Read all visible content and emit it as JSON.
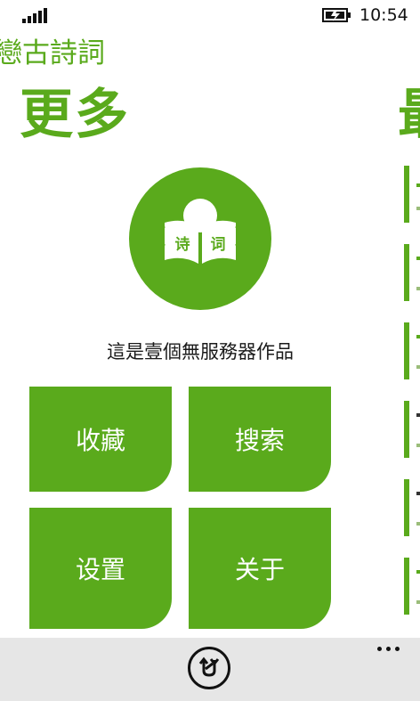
{
  "status_bar": {
    "time": "10:54",
    "signal_icon": "signal-strength-icon",
    "battery_icon": "battery-charging-icon"
  },
  "app": {
    "title": "戀古詩詞",
    "pivot_current": "更多",
    "pivot_next_peek": "最"
  },
  "logo": {
    "icon": "book-reader-icon",
    "text_left": "诗",
    "text_right": "词"
  },
  "subtitle": "這是壹個無服務器作品",
  "tiles": {
    "collect": "收藏",
    "search": "搜索",
    "settings": "设置",
    "about": "关于"
  },
  "app_bar": {
    "button_icon": "sync-icon",
    "more_icon": "ellipsis-icon"
  },
  "colors": {
    "accent": "#5aaa1c",
    "app_bar_bg": "#e6e6e6"
  }
}
